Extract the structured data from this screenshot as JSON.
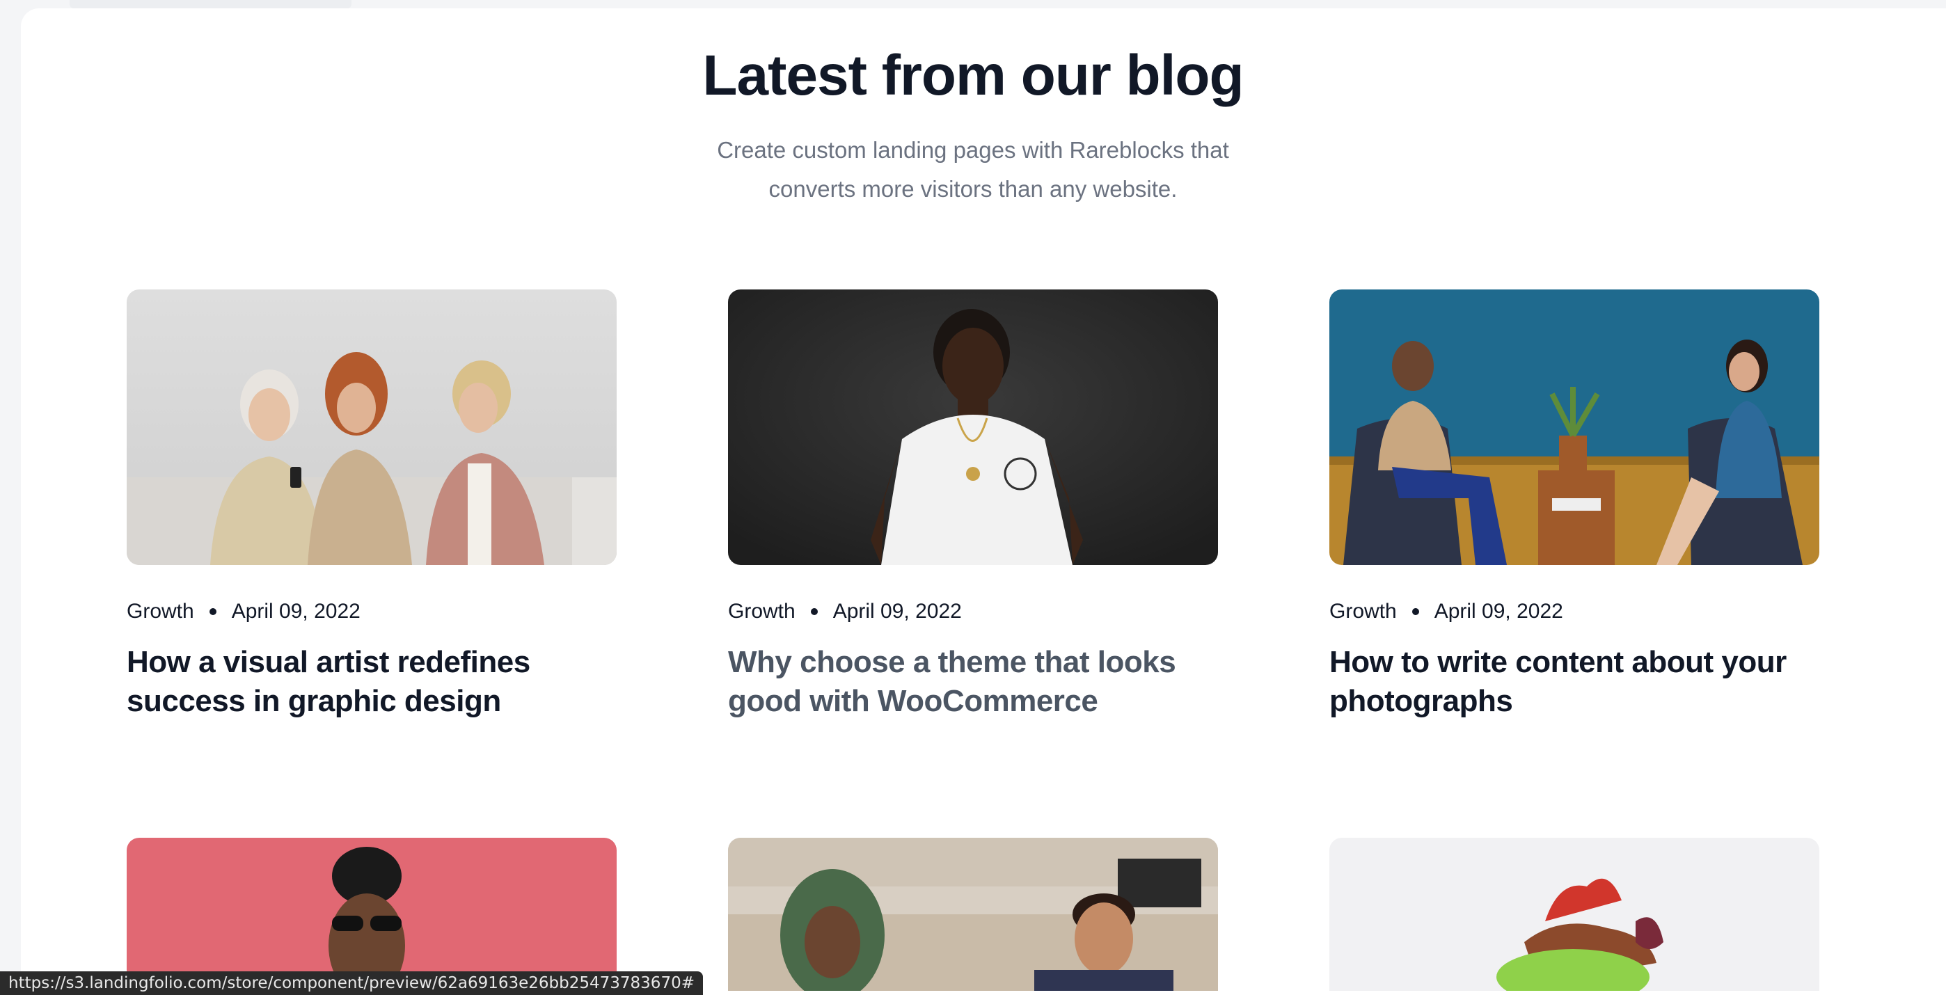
{
  "header": {
    "title": "Latest from our blog",
    "subtitle_line1": "Create custom landing pages with Rareblocks that",
    "subtitle_line2": "converts more visitors than any website."
  },
  "posts": [
    {
      "category": "Growth",
      "date": "April 09, 2022",
      "title_line1": "How a visual artist redefines",
      "title_line2": "success in graphic design",
      "image": "three-women-on-sofa"
    },
    {
      "category": "Growth",
      "date": "April 09, 2022",
      "title_line1": "Why choose a theme that looks",
      "title_line2": "good with WooCommerce",
      "image": "man-in-white-tshirt"
    },
    {
      "category": "Growth",
      "date": "April 09, 2022",
      "title_line1": "How to write content about your",
      "title_line2": "photographs",
      "image": "two-people-in-chairs"
    }
  ],
  "more_posts_images": [
    "woman-with-sunglasses",
    "colleagues-at-laptop",
    "dessert-plate"
  ],
  "status_bar": {
    "url": "https://s3.landingfolio.com/store/component/preview/62a69163e26bb25473783670#"
  },
  "colors": {
    "text_primary": "#111827",
    "text_secondary": "#6b7280",
    "title_hover": "#4b5563",
    "page_background": "#f4f5f7"
  }
}
